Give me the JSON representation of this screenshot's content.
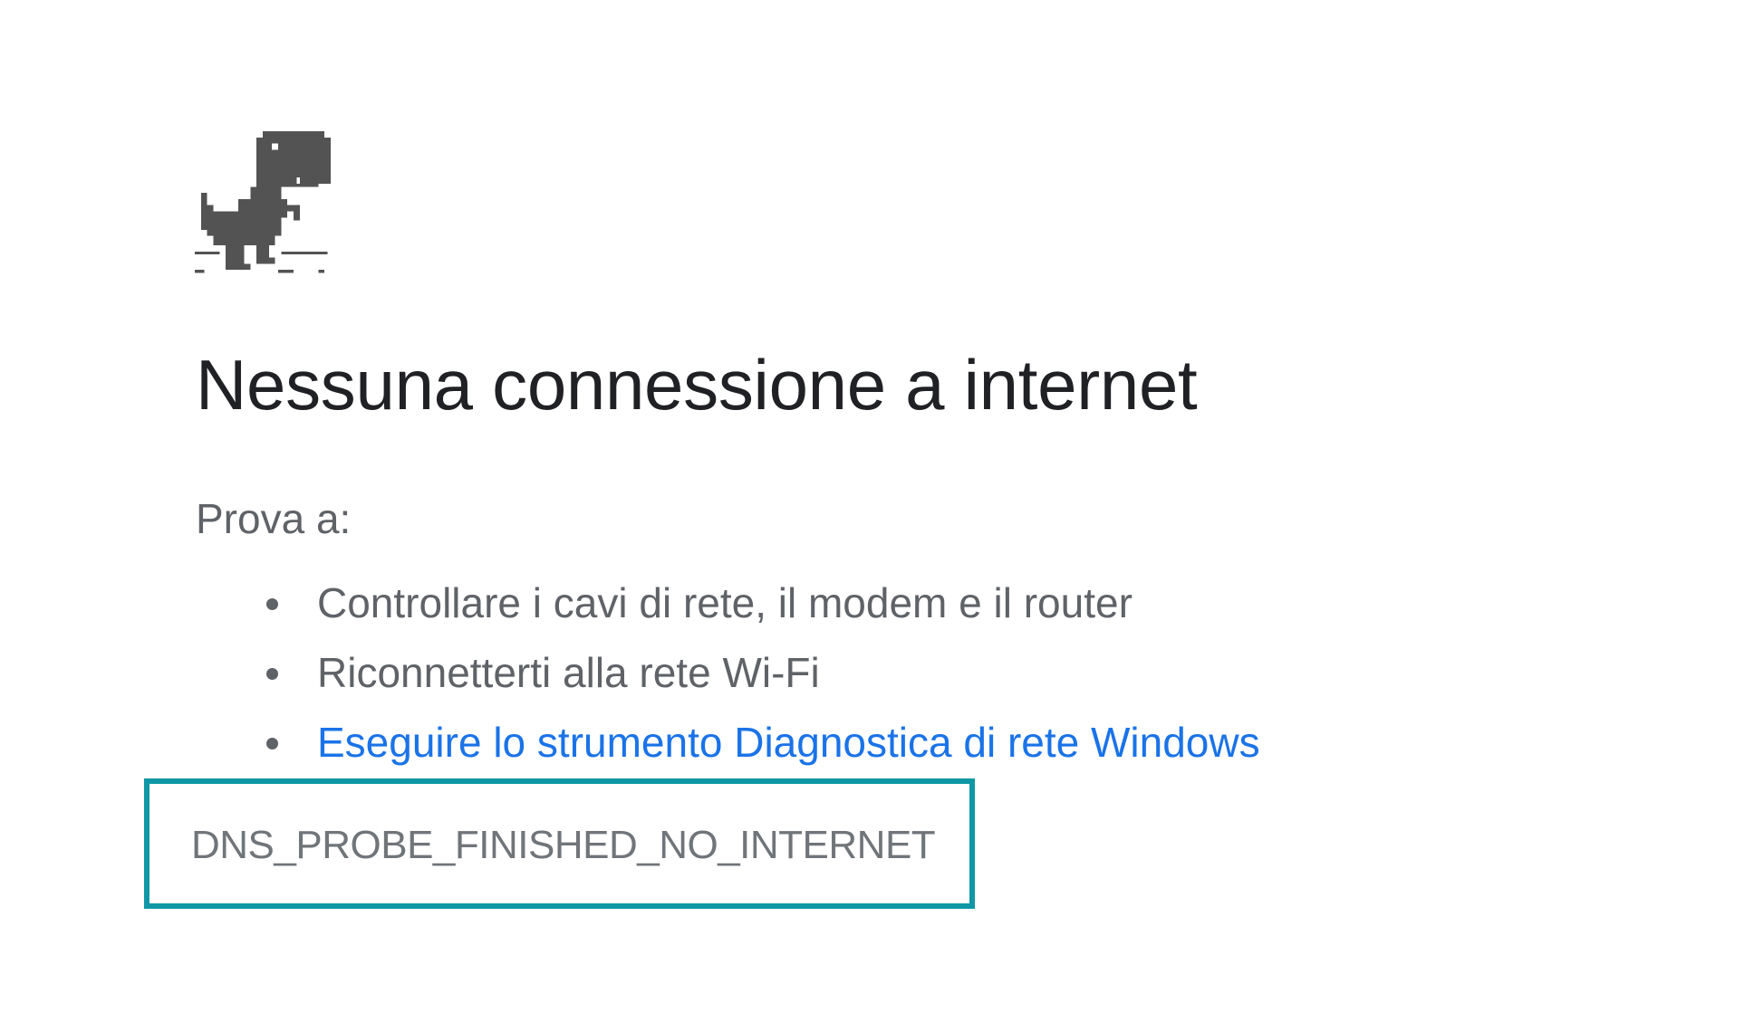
{
  "icons": {
    "dino": "offline-dino-icon",
    "bullet": "bullet-icon"
  },
  "colors": {
    "title": "#202124",
    "body_text": "#5f6368",
    "link": "#1a73e8",
    "dino": "#535353",
    "highlight_box": "#0f97a6",
    "error_code": "#70757a"
  },
  "title": "Nessuna connessione a internet",
  "suggestions_heading": "Prova a:",
  "suggestions": [
    {
      "label": "Controllare i cavi di rete, il modem e il router"
    },
    {
      "label": "Riconnetterti alla rete Wi-Fi"
    },
    {
      "label": "Eseguire lo strumento Diagnostica di rete Windows"
    }
  ],
  "error_code": "DNS_PROBE_FINISHED_NO_INTERNET"
}
